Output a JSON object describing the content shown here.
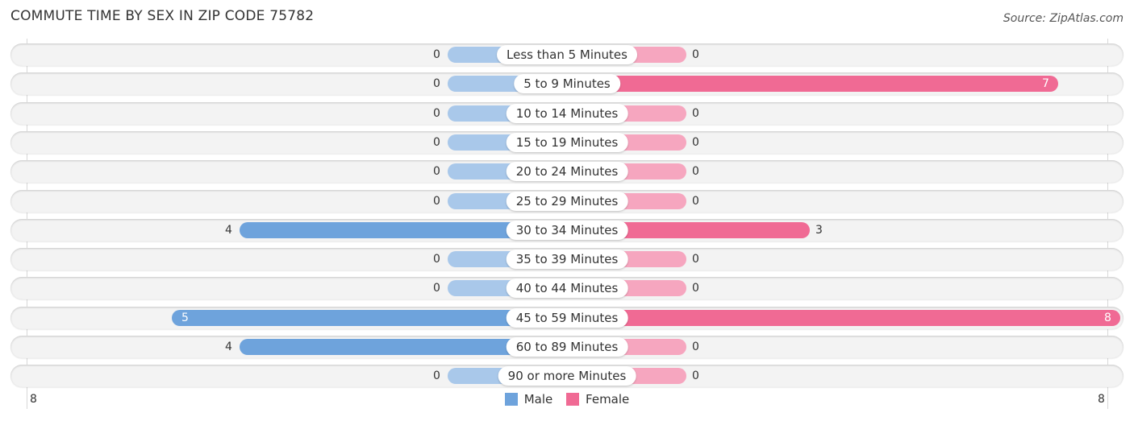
{
  "chart_data": {
    "type": "bar",
    "orientation": "horizontal-diverging",
    "title": "COMMUTE TIME BY SEX IN ZIP CODE 75782",
    "source": "Source: ZipAtlas.com",
    "categories": [
      "Less than 5 Minutes",
      "5 to 9 Minutes",
      "10 to 14 Minutes",
      "15 to 19 Minutes",
      "20 to 24 Minutes",
      "25 to 29 Minutes",
      "30 to 34 Minutes",
      "35 to 39 Minutes",
      "40 to 44 Minutes",
      "45 to 59 Minutes",
      "60 to 89 Minutes",
      "90 or more Minutes"
    ],
    "series": [
      {
        "name": "Male",
        "color": "#6ea3dc",
        "values": [
          0,
          0,
          0,
          0,
          0,
          0,
          4,
          0,
          0,
          5,
          4,
          0
        ]
      },
      {
        "name": "Female",
        "color": "#f06a94",
        "values": [
          0,
          7,
          0,
          0,
          0,
          0,
          3,
          0,
          0,
          8,
          0,
          0
        ]
      }
    ],
    "axis": {
      "left_tick": "8",
      "right_tick": "8",
      "max": 8
    },
    "legend": {
      "position": "bottom-center",
      "items": [
        "Male",
        "Female"
      ]
    }
  }
}
